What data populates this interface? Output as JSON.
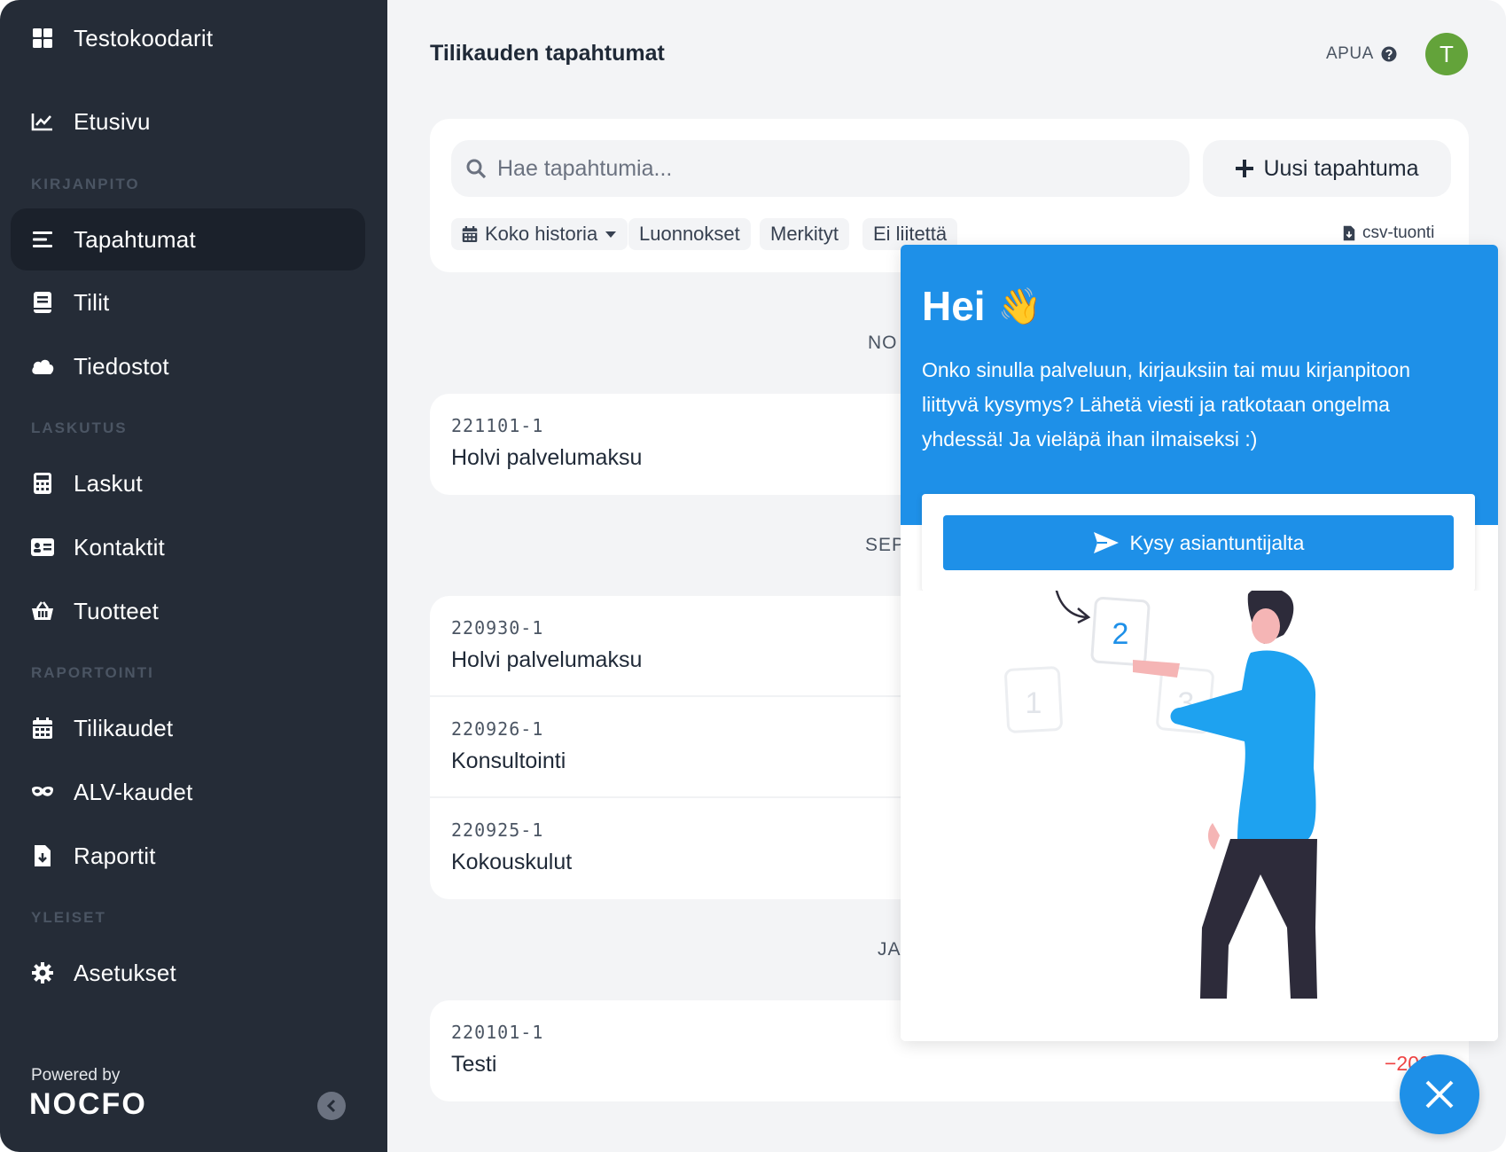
{
  "sidebar": {
    "org_name": "Testokoodarit",
    "home": "Etusivu",
    "sections": [
      "KIRJANPITO",
      "LASKUTUS",
      "RAPORTOINTI",
      "YLEISET"
    ],
    "items": {
      "tapahtumat": "Tapahtumat",
      "tilit": "Tilit",
      "tiedostot": "Tiedostot",
      "laskut": "Laskut",
      "kontaktit": "Kontaktit",
      "tuotteet": "Tuotteet",
      "tilikaudet": "Tilikaudet",
      "alv": "ALV-kaudet",
      "raportit": "Raportit",
      "asetukset": "Asetukset"
    },
    "powered_by": "Powered by",
    "brand": "NOCFO"
  },
  "header": {
    "title": "Tilikauden tapahtumat",
    "help": "APUA",
    "avatar_initial": "T"
  },
  "toolbar": {
    "search_placeholder": "Hae tapahtumia...",
    "new_button": "Uusi tapahtuma",
    "filters": [
      "Koko historia",
      "Luonnokset",
      "Merkityt",
      "Ei liitettä"
    ],
    "csv": "csv-tuonti"
  },
  "months": [
    "NO",
    "SEP",
    "JA"
  ],
  "groups": [
    {
      "rows": [
        {
          "code": "221101-1",
          "desc": "Holvi palvelumaksu",
          "amount": ""
        }
      ]
    },
    {
      "rows": [
        {
          "code": "220930-1",
          "desc": "Holvi palvelumaksu",
          "amount": ""
        },
        {
          "code": "220926-1",
          "desc": "Konsultointi",
          "amount": ""
        },
        {
          "code": "220925-1",
          "desc": "Kokouskulut",
          "amount": ""
        }
      ]
    },
    {
      "rows": [
        {
          "code": "220101-1",
          "desc": "Testi",
          "amount": "−200,0"
        }
      ]
    }
  ],
  "chat": {
    "title": "Hei",
    "emoji": "👋",
    "text": "Onko sinulla palveluun, kirjauksiin tai muu kirjanpitoon liittyvä kysymys? Lähetä viesti ja ratkotaan ongelma yhdessä! Ja vieläpä ihan ilmaiseksi :)",
    "button": "Kysy asiantuntijalta",
    "illustration_digits": [
      "1",
      "2",
      "3"
    ]
  },
  "colors": {
    "sidebar_bg": "#252c37",
    "accent_blue": "#1e90e8",
    "avatar_green": "#63a33a",
    "negative_red": "#ef4444"
  }
}
